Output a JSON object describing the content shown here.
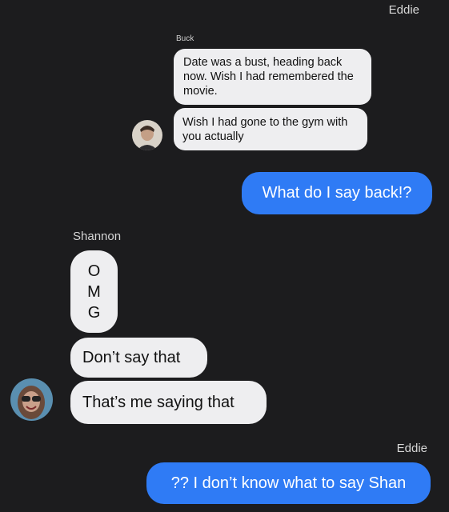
{
  "header": {
    "sender_right": "Eddie"
  },
  "thread1": {
    "sender": "Buck",
    "messages": [
      "Date was a bust, heading back now. Wish I had remembered the movie.",
      "Wish I had gone to the gym with you actually"
    ]
  },
  "outgoing1": {
    "text": "What do I say back!?"
  },
  "thread2": {
    "sender": "Shannon",
    "omg": [
      "O",
      "M",
      "G"
    ],
    "messages": [
      "Don’t say that",
      "That’s me saying that"
    ]
  },
  "outgoing2": {
    "sender": "Eddie",
    "text": "?? I don’t know what to say Shan"
  },
  "colors": {
    "background": "#1c1c1e",
    "outgoing_bubble": "#2f7bf5",
    "incoming_bubble": "#eeeef0"
  }
}
